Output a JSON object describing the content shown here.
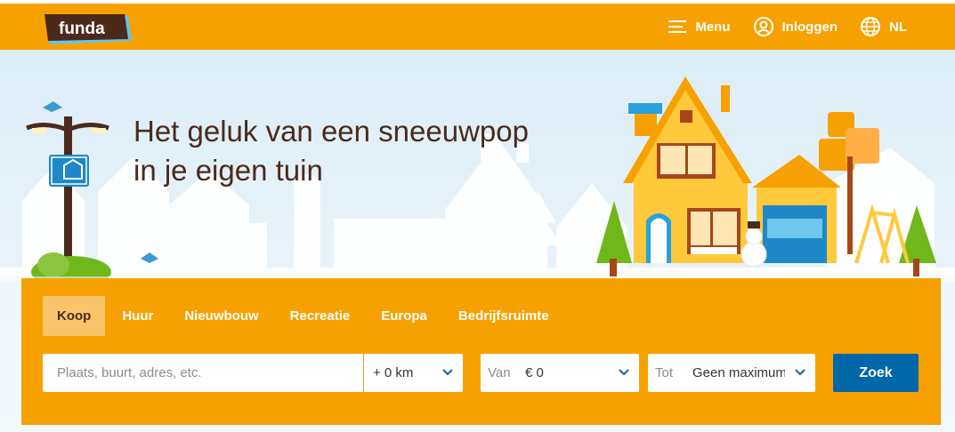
{
  "header": {
    "logo_text": "funda",
    "menu_label": "Menu",
    "login_label": "Inloggen",
    "language_label": "NL"
  },
  "hero": {
    "headline_line1": "Het geluk van een sneeuwpop",
    "headline_line2": "in je eigen tuin"
  },
  "search": {
    "tabs": [
      {
        "label": "Koop",
        "active": true
      },
      {
        "label": "Huur",
        "active": false
      },
      {
        "label": "Nieuwbouw",
        "active": false
      },
      {
        "label": "Recreatie",
        "active": false
      },
      {
        "label": "Europa",
        "active": false
      },
      {
        "label": "Bedrijfsruimte",
        "active": false
      }
    ],
    "location_placeholder": "Plaats, buurt, adres, etc.",
    "radius_value": "+ 0 km",
    "price_from_prefix": "Van",
    "price_from_value": "€ 0",
    "price_to_prefix": "Tot",
    "price_to_value": "Geen maximum",
    "submit_label": "Zoek"
  },
  "colors": {
    "brand_orange": "#f7a100",
    "active_tab": "#fac56a",
    "button_blue": "#0067a9",
    "headline_brown": "#4b2a1c"
  }
}
